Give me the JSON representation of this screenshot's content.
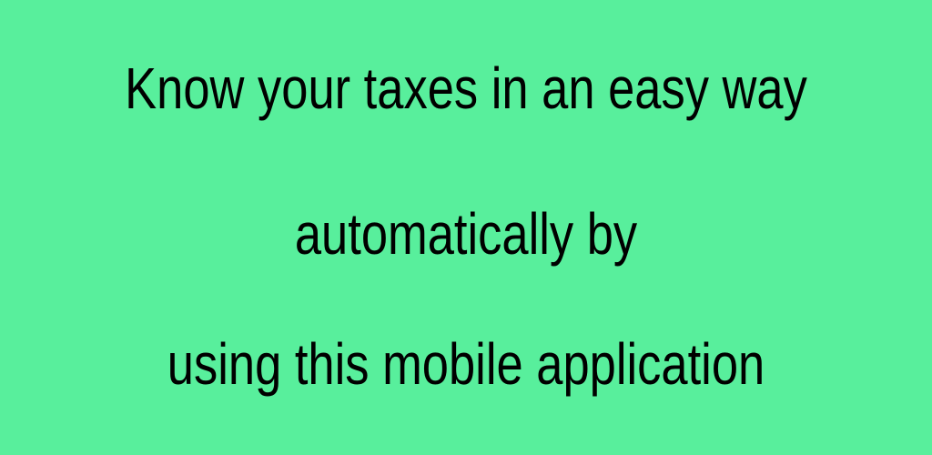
{
  "banner": {
    "background_color": "#58EF9C",
    "text_color": "#000000",
    "lines": [
      "Know your taxes in an easy way",
      "automatically by",
      "using this mobile application"
    ]
  }
}
